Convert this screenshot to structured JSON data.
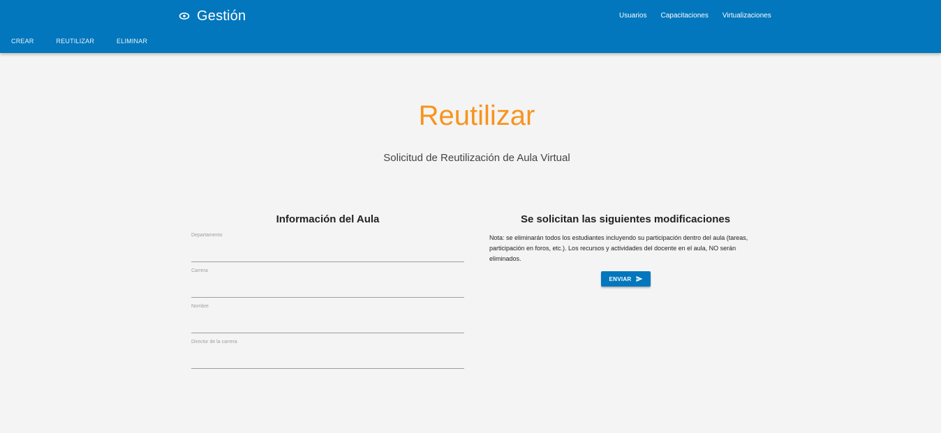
{
  "header": {
    "brand_label": "Gestión",
    "brand_icon": "eye-icon",
    "nav_links": [
      {
        "label": "Usuarios"
      },
      {
        "label": "Capacitaciones"
      },
      {
        "label": "Virtualizaciones"
      }
    ],
    "tabs": [
      {
        "label": "CREAR"
      },
      {
        "label": "REUTILIZAR"
      },
      {
        "label": "ELIMINAR"
      }
    ]
  },
  "main": {
    "title": "Reutilizar",
    "subtitle": "Solicitud de Reutilización de Aula Virtual",
    "left_section": {
      "title": "Información del Aula",
      "fields": [
        {
          "label": "Departamento",
          "value": ""
        },
        {
          "label": "Carrera",
          "value": ""
        },
        {
          "label": "Nombre",
          "value": ""
        },
        {
          "label": "Director de la carrera",
          "value": ""
        }
      ]
    },
    "right_section": {
      "title": "Se solicitan las siguientes modificaciones",
      "note": "Nota: se eliminarán todos los estudiantes incluyendo su participación dentro del aula (tareas, participación en foros, etc.). Los recursos y actividades del docente en el aula, NO serán eliminados.",
      "send_label": "ENVIAR",
      "send_icon": "send-icon"
    }
  },
  "colors": {
    "primary": "#0277bd",
    "title_accent": "#f7941d",
    "background": "#f4f4f4"
  }
}
